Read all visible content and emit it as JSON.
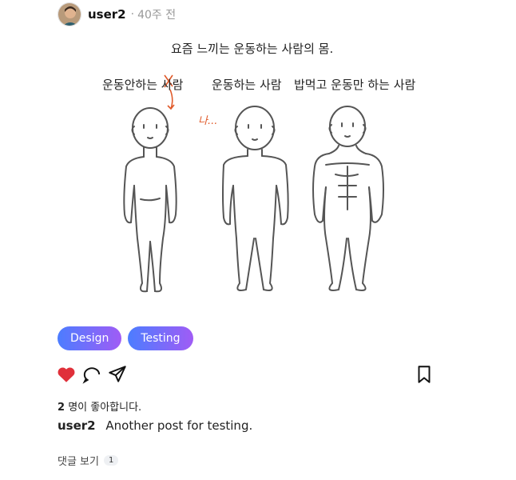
{
  "post": {
    "username": "user2",
    "separator": "·",
    "time": "40주 전",
    "image": {
      "title": "요즘 느끼는 운동하는 사람의 몸.",
      "col1_label": "운동안하는 사람",
      "col2_label": "운동하는 사람",
      "col3_label": "밥먹고 운동만 하는 사람",
      "annotation": "나..."
    },
    "tags": [
      "Design",
      "Testing"
    ],
    "likes_count": "2",
    "likes_text": "명이 좋아합니다.",
    "caption_user": "user2",
    "caption_text": "Another post for testing.",
    "comments_label": "댓글 보기",
    "comments_count": "1"
  },
  "icons": {
    "like": "heart-icon",
    "comment": "comment-icon",
    "share": "send-icon",
    "save": "bookmark-icon"
  },
  "colors": {
    "like_red": "#e0303a",
    "tag_gradient_start": "#4c7dff",
    "tag_gradient_end": "#a05cf5",
    "annotation_red": "#e05a2a"
  }
}
